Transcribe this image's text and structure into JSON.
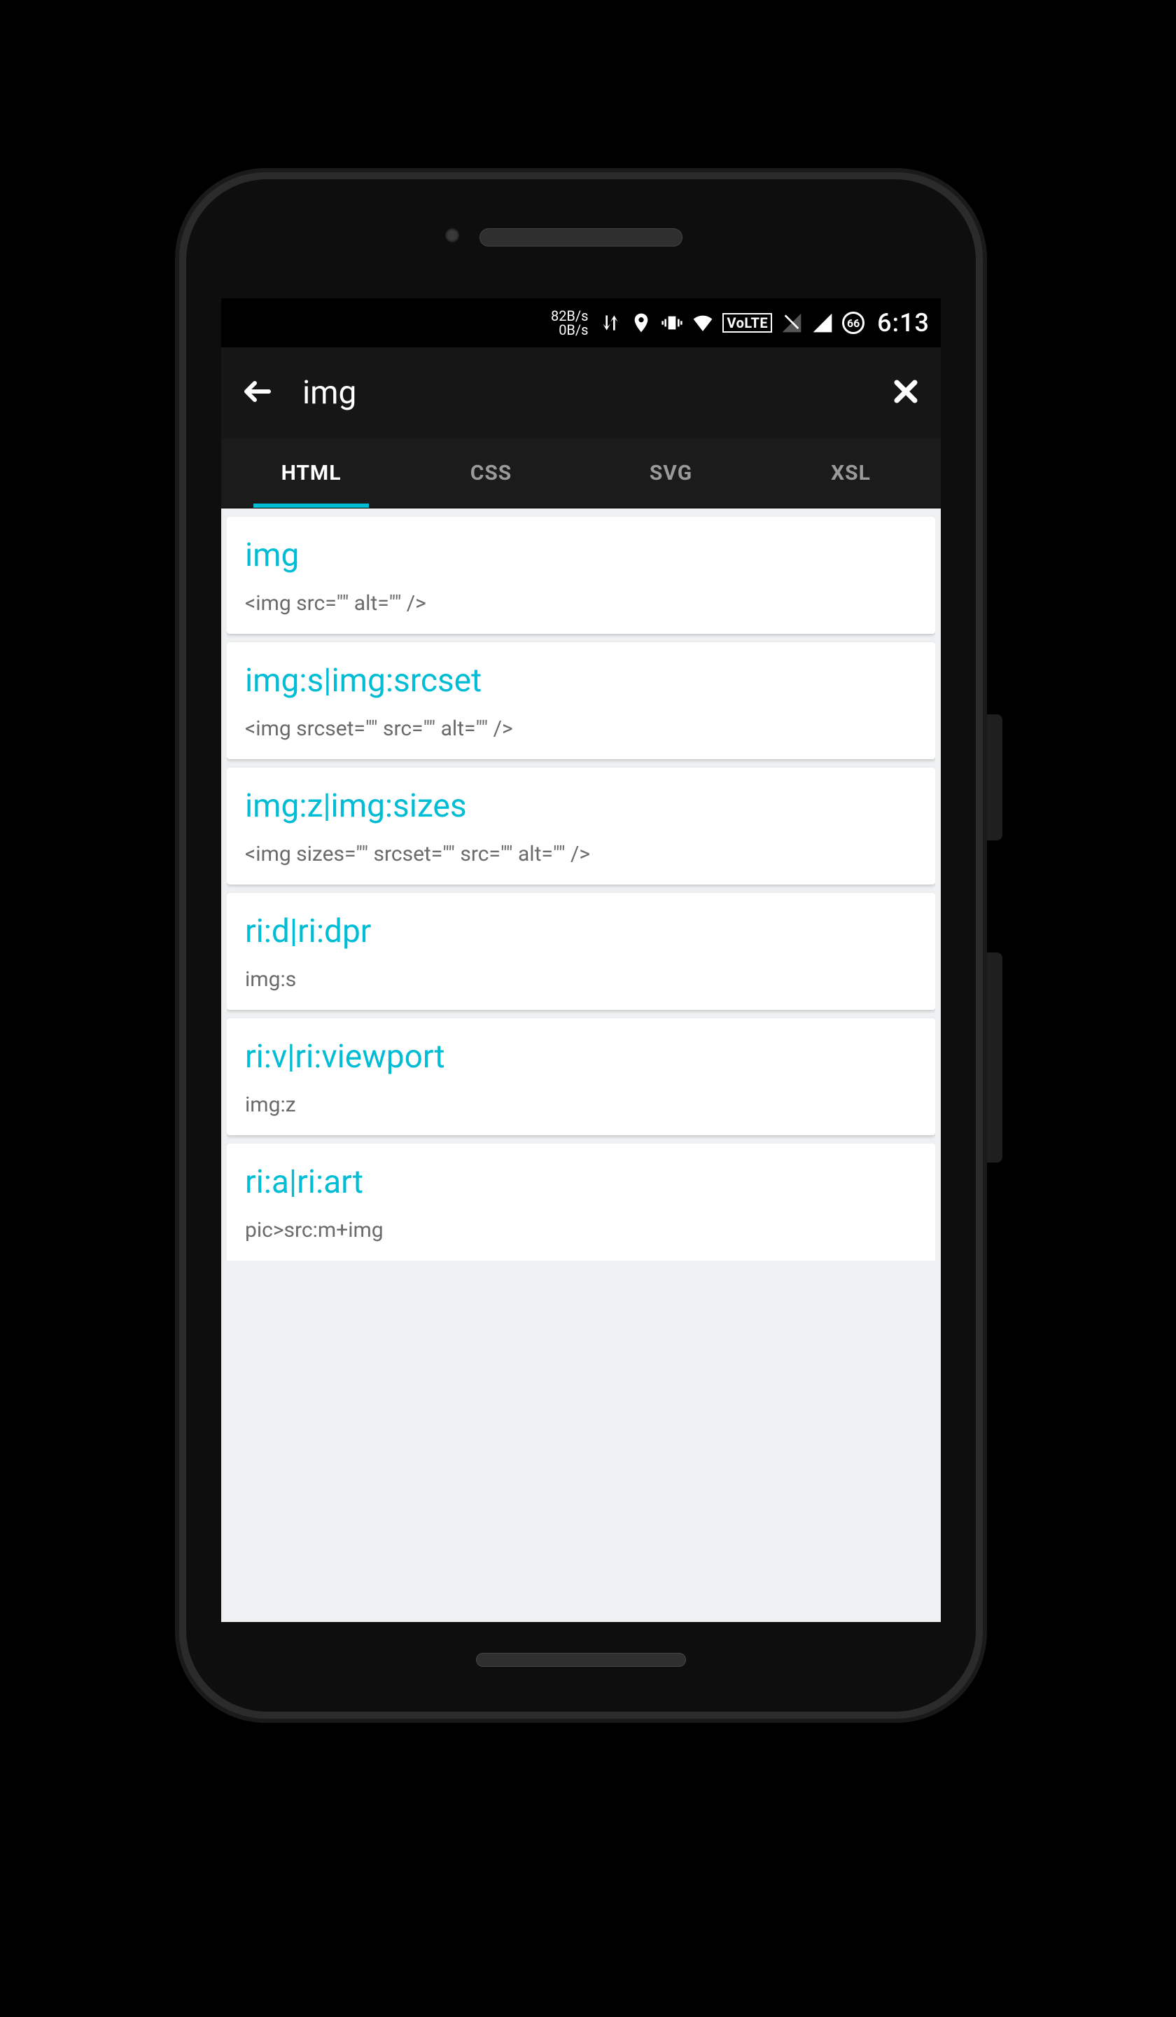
{
  "status": {
    "speed_up": "82B/s",
    "speed_down": "0B/s",
    "volte": "VoLTE",
    "battery": "66",
    "time": "6:13"
  },
  "search": {
    "query": "img"
  },
  "tabs": [
    {
      "label": "HTML",
      "active": true
    },
    {
      "label": "CSS",
      "active": false
    },
    {
      "label": "SVG",
      "active": false
    },
    {
      "label": "XSL",
      "active": false
    }
  ],
  "results": [
    {
      "title": "img",
      "sub": "<img src=\"\" alt=\"\" />"
    },
    {
      "title": "img:s|img:srcset",
      "sub": "<img srcset=\"\" src=\"\" alt=\"\" />"
    },
    {
      "title": "img:z|img:sizes",
      "sub": "<img sizes=\"\" srcset=\"\" src=\"\" alt=\"\" />"
    },
    {
      "title": "ri:d|ri:dpr",
      "sub": "img:s"
    },
    {
      "title": "ri:v|ri:viewport",
      "sub": "img:z"
    },
    {
      "title": "ri:a|ri:art",
      "sub": "pic>src:m+img"
    }
  ],
  "colors": {
    "accent": "#00bcd4"
  }
}
